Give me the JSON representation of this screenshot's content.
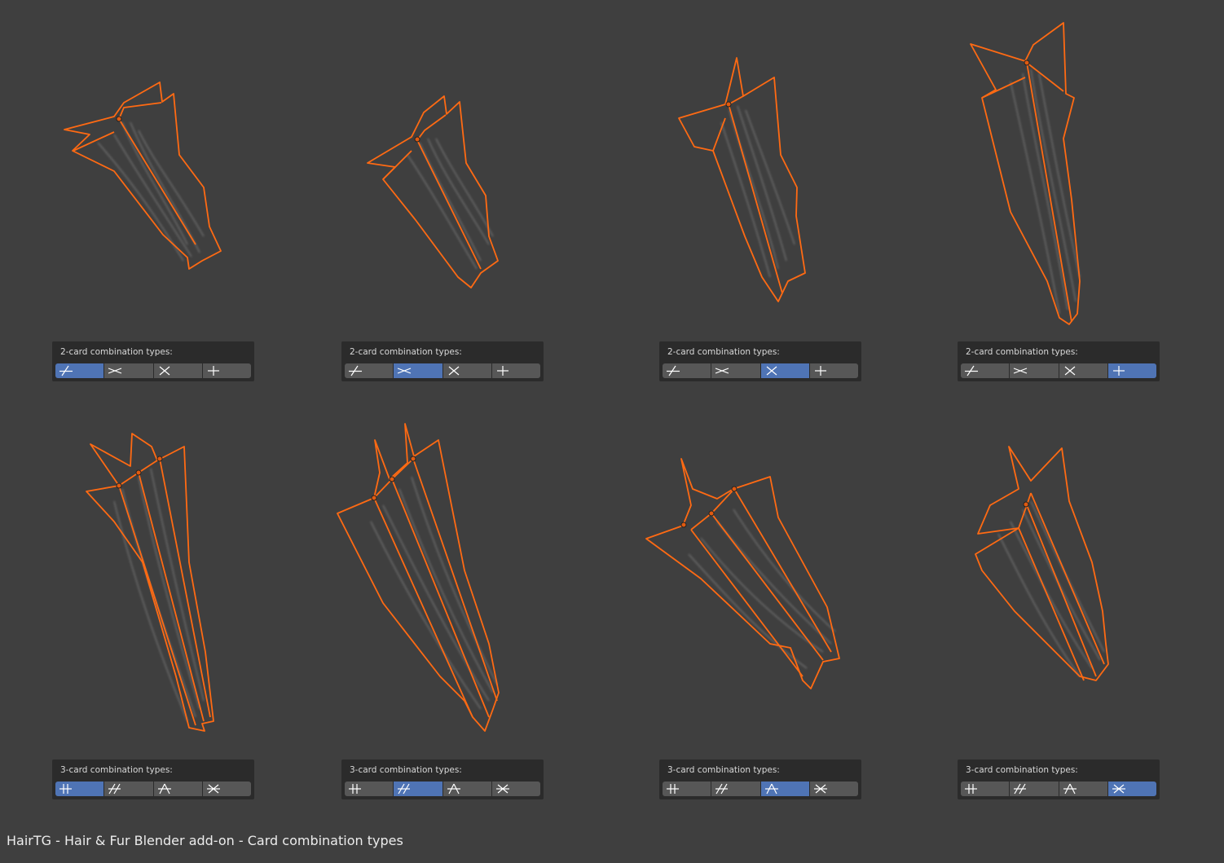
{
  "caption": "HairTG - Hair & Fur Blender add-on - Card combination types",
  "colors": {
    "background": "#3f3f3f",
    "panel": "#2b2b2b",
    "button": "#575757",
    "button_active": "#4f74b5",
    "card_outline": "#ff6a13"
  },
  "panels": [
    {
      "label": "2-card combination types:",
      "selected": 0,
      "icons": [
        "two-card-slash-icon",
        "two-card-scissor-icon",
        "two-card-x-icon",
        "two-card-cross-icon"
      ]
    },
    {
      "label": "2-card combination types:",
      "selected": 1,
      "icons": [
        "two-card-slash-icon",
        "two-card-scissor-icon",
        "two-card-x-icon",
        "two-card-cross-icon"
      ]
    },
    {
      "label": "2-card combination types:",
      "selected": 2,
      "icons": [
        "two-card-slash-icon",
        "two-card-scissor-icon",
        "two-card-x-icon",
        "two-card-cross-icon"
      ]
    },
    {
      "label": "2-card combination types:",
      "selected": 3,
      "icons": [
        "two-card-slash-icon",
        "two-card-scissor-icon",
        "two-card-x-icon",
        "two-card-cross-icon"
      ]
    },
    {
      "label": "3-card combination types:",
      "selected": 0,
      "icons": [
        "three-card-parallel-icon",
        "three-card-hash-icon",
        "three-card-a-icon",
        "three-card-star-icon"
      ]
    },
    {
      "label": "3-card combination types:",
      "selected": 1,
      "icons": [
        "three-card-parallel-icon",
        "three-card-hash-icon",
        "three-card-a-icon",
        "three-card-star-icon"
      ]
    },
    {
      "label": "3-card combination types:",
      "selected": 2,
      "icons": [
        "three-card-parallel-icon",
        "three-card-hash-icon",
        "three-card-a-icon",
        "three-card-star-icon"
      ]
    },
    {
      "label": "3-card combination types:",
      "selected": 3,
      "icons": [
        "three-card-parallel-icon",
        "three-card-hash-icon",
        "three-card-a-icon",
        "three-card-star-icon"
      ]
    }
  ]
}
